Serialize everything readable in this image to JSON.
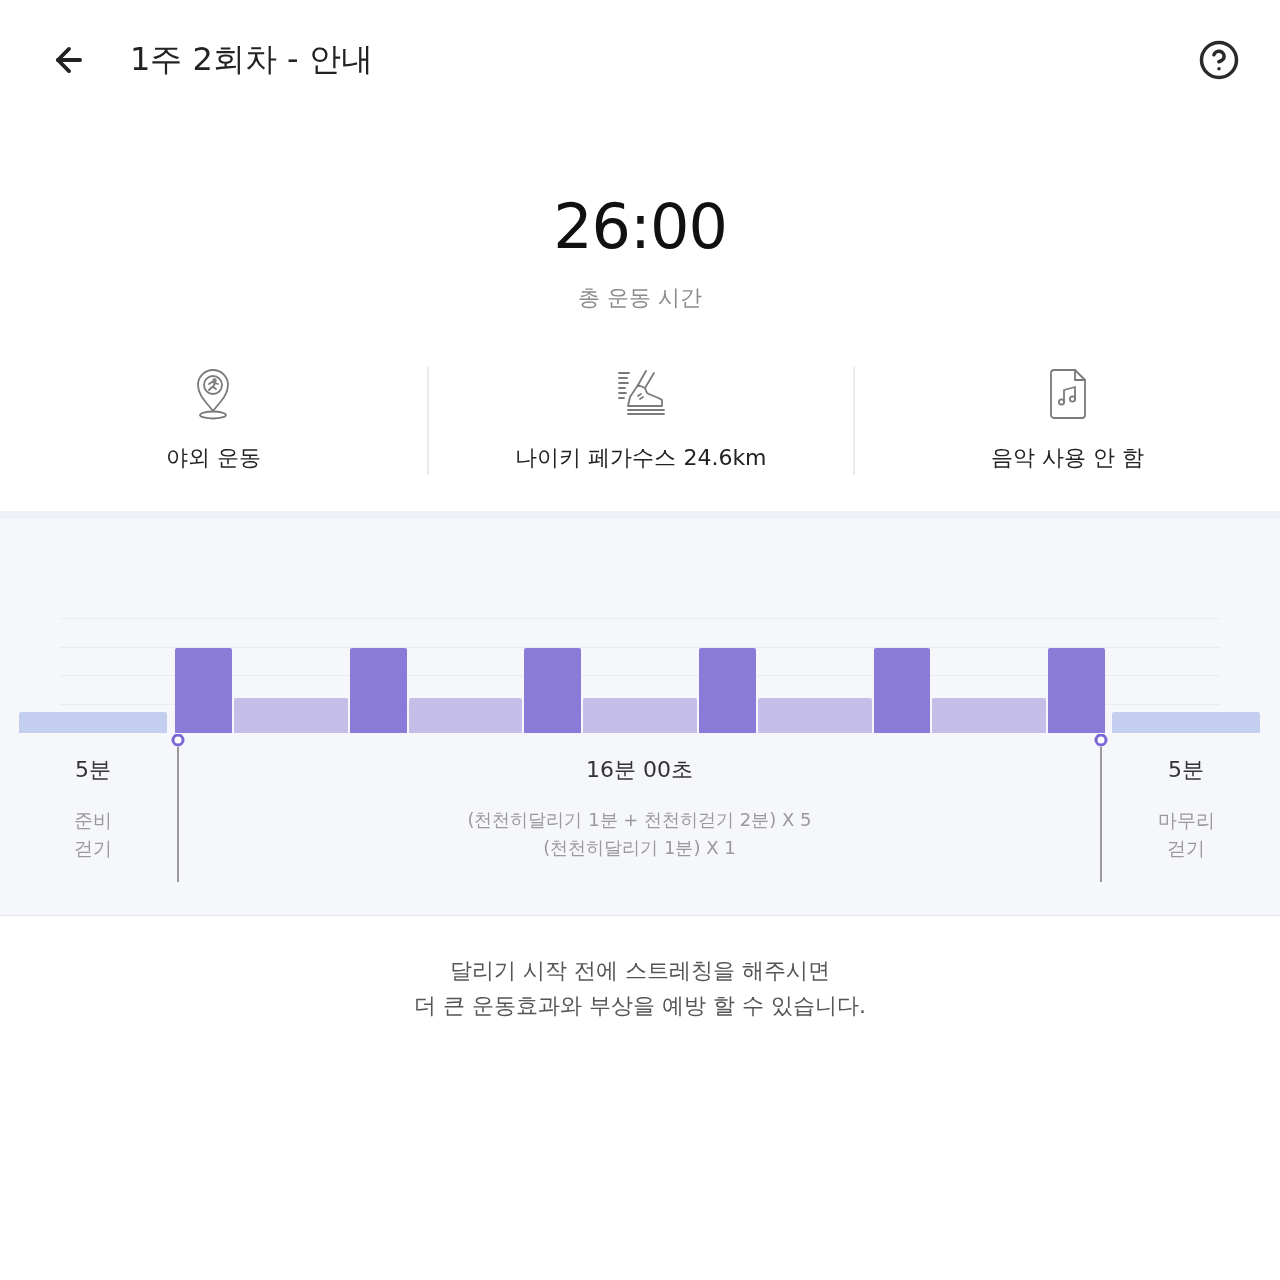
{
  "header": {
    "title": "1주 2회차 - 안내"
  },
  "summary": {
    "total_time": "26:00",
    "total_time_label": "총 운동 시간"
  },
  "info_items": [
    {
      "kind": "location",
      "label": "야외 운동"
    },
    {
      "kind": "shoe",
      "label": "나이키 페가수스 24.6km"
    },
    {
      "kind": "music",
      "label": "음악 사용 안 함"
    }
  ],
  "workout_plan": {
    "segments": [
      {
        "kind": "warmup"
      },
      {
        "kind": "run"
      },
      {
        "kind": "walk"
      },
      {
        "kind": "run"
      },
      {
        "kind": "walk"
      },
      {
        "kind": "run"
      },
      {
        "kind": "walk"
      },
      {
        "kind": "run"
      },
      {
        "kind": "walk"
      },
      {
        "kind": "run"
      },
      {
        "kind": "walk"
      },
      {
        "kind": "run"
      },
      {
        "kind": "cooldown"
      }
    ],
    "warmup": {
      "duration": "5분",
      "label": "준비 걷기"
    },
    "main": {
      "duration": "16분 00초",
      "details": [
        "(천천히달리기 1분 + 천천히걷기 2분) X 5",
        "(천천히달리기 1분) X 1"
      ]
    },
    "cooldown": {
      "duration": "5분",
      "label": "마무리 걷기"
    }
  },
  "tip": "달리기 시작 전에 스트레칭을 해주시면\n더 큰 운동효과와 부상을 예방 할 수 있습니다."
}
